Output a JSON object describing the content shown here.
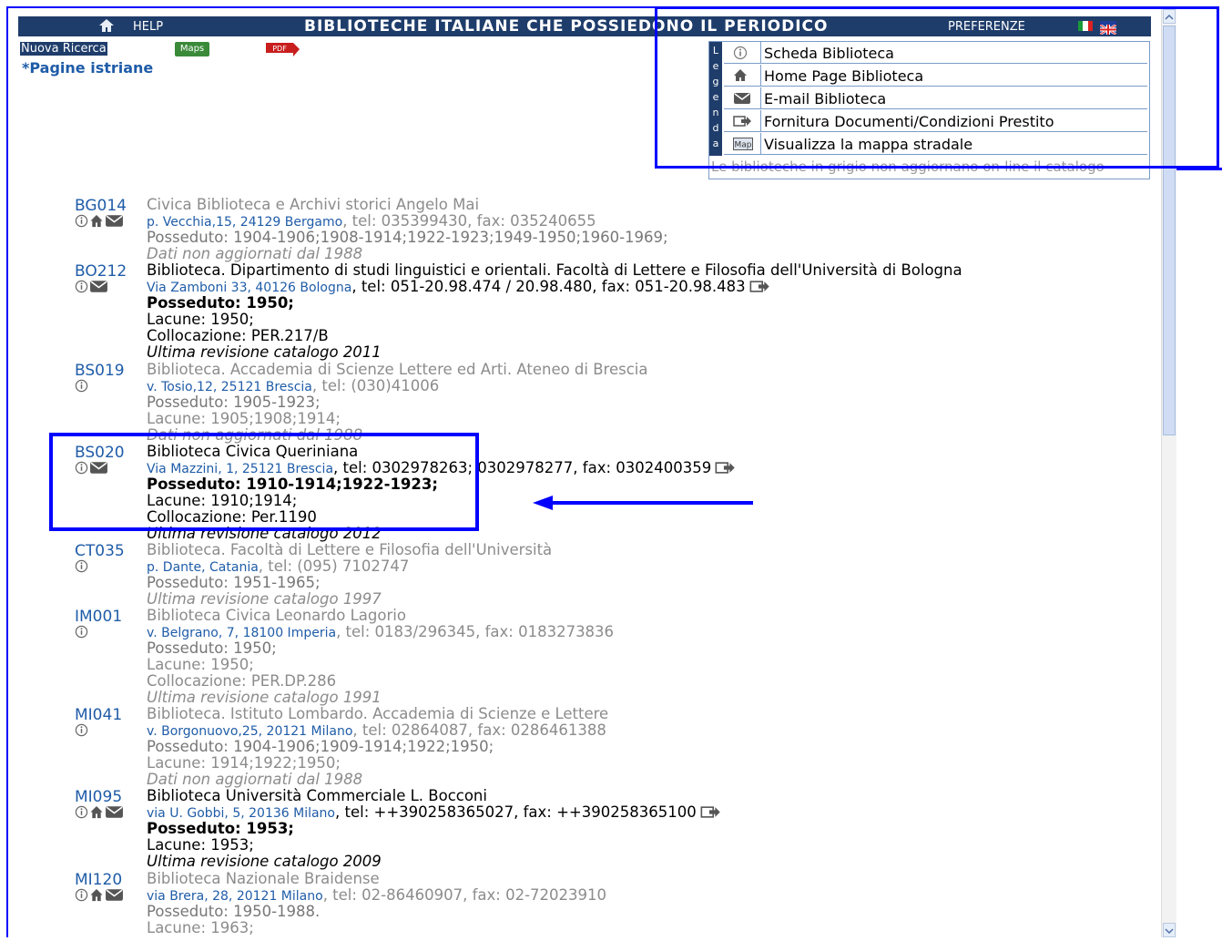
{
  "header": {
    "help": "HELP",
    "title": "BIBLIOTECHE ITALIANE CHE POSSIEDONO IL PERIODICO",
    "preferences": "PREFERENZE"
  },
  "toolbar": {
    "nuova_ricerca": "Nuova Ricerca",
    "maps_label": "Maps",
    "pdf_label": "PDF",
    "pagine_istriane": "*Pagine istriane"
  },
  "legend": {
    "side_letters": [
      "L",
      "e",
      "g",
      "e",
      "n",
      "d",
      "a"
    ],
    "items": [
      {
        "icon": "info-icon",
        "label": "Scheda Biblioteca"
      },
      {
        "icon": "home-icon",
        "label": "Home Page Biblioteca"
      },
      {
        "icon": "email-icon",
        "label": "E-mail Biblioteca"
      },
      {
        "icon": "document-delivery-icon",
        "label": "Fornitura Documenti/Condizioni Prestito"
      },
      {
        "icon": "map-icon",
        "label": "Visualizza la mappa stradale"
      }
    ],
    "footnote": "Le biblioteche in grigio non aggiornano on-line il catalogo"
  },
  "entries": [
    {
      "code": "BG014",
      "name": "Civica Biblioteca e Archivi storici Angelo Mai",
      "address": "p. Vecchia,15, 24129 Bergamo",
      "contact": ", tel: 035399430, fax: 035240655",
      "posseduto": "Posseduto: 1904-1906;1908-1914;1922-1923;1949-1950;1960-1969;",
      "note": "Dati non aggiornati dal 1988"
    },
    {
      "code": "BO212",
      "name": "Biblioteca. Dipartimento di studi linguistici e orientali. Facoltà di Lettere e Filosofia dell'Università di Bologna",
      "address": "Via Zamboni 33, 40126 Bologna",
      "contact": ", tel: 051-20.98.474 / 20.98.480, fax: 051-20.98.483",
      "posseduto": "Posseduto: 1950;",
      "lacune": "Lacune: 1950;",
      "collocazione": "Collocazione: PER.217/B",
      "note": "Ultima revisione catalogo 2011"
    },
    {
      "code": "BS019",
      "name": "Biblioteca. Accademia di Scienze Lettere ed Arti. Ateneo di Brescia",
      "address": "v. Tosio,12, 25121 Brescia",
      "contact": ", tel: (030)41006",
      "posseduto": "Posseduto: 1905-1923;",
      "lacune": "Lacune: 1905;1908;1914;",
      "note": "Dati non aggiornati dal 1988"
    },
    {
      "code": "BS020",
      "name": "Biblioteca Civica Queriniana",
      "address": "Via Mazzini, 1, 25121 Brescia",
      "contact": ", tel: 0302978263; 0302978277, fax: 0302400359",
      "posseduto": "Posseduto: 1910-1914;1922-1923;",
      "lacune": "Lacune: 1910;1914;",
      "collocazione": "Collocazione: Per.1190",
      "note": "Ultima revisione catalogo 2012"
    },
    {
      "code": "CT035",
      "name": "Biblioteca. Facoltà di Lettere e Filosofia dell'Università",
      "address": "p. Dante, Catania",
      "contact": ", tel: (095) 7102747",
      "posseduto": "Posseduto: 1951-1965;",
      "note": "Ultima revisione catalogo 1997"
    },
    {
      "code": "IM001",
      "name": "Biblioteca Civica Leonardo Lagorio",
      "address": "v. Belgrano, 7, 18100 Imperia",
      "contact": ", tel: 0183/296345, fax: 0183273836",
      "posseduto": "Posseduto: 1950;",
      "lacune": "Lacune: 1950;",
      "collocazione": "Collocazione: PER.DP.286",
      "note": "Ultima revisione catalogo 1991"
    },
    {
      "code": "MI041",
      "name": "Biblioteca. Istituto Lombardo. Accademia di Scienze e Lettere",
      "address": "v. Borgonuovo,25, 20121 Milano",
      "contact": ", tel: 02864087, fax: 0286461388",
      "posseduto": "Posseduto: 1904-1906;1909-1914;1922;1950;",
      "lacune": "Lacune: 1914;1922;1950;",
      "note": "Dati non aggiornati dal 1988"
    },
    {
      "code": "MI095",
      "name": "Biblioteca Università Commerciale L. Bocconi",
      "address": "via U. Gobbi, 5, 20136 Milano",
      "contact": ", tel: ++390258365027, fax: ++390258365100",
      "posseduto": "Posseduto: 1953;",
      "lacune": "Lacune: 1953;",
      "note": "Ultima revisione catalogo 2009"
    },
    {
      "code": "MI120",
      "name": "Biblioteca Nazionale Braidense",
      "address": "via Brera, 28, 20121 Milano",
      "contact": ", tel: 02-86460907, fax: 02-72023910",
      "posseduto": "Posseduto: 1950-1988.",
      "lacune": "Lacune: 1963;"
    }
  ],
  "colors": {
    "header_bg": "#1f3d6b",
    "link": "#1f5ca8",
    "annotation": "#0000ff",
    "grey_text": "#8c8c8c"
  }
}
